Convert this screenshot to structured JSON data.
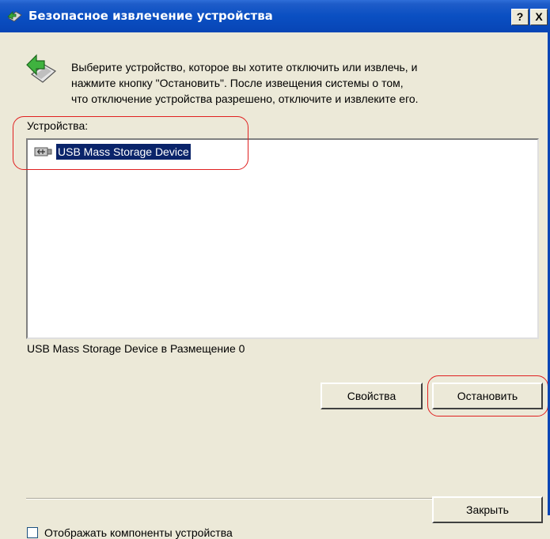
{
  "window": {
    "title": "Безопасное извлечение устройства",
    "help_button": "?",
    "close_button": "X"
  },
  "intro": {
    "line1": "Выберите устройство, которое вы хотите отключить или извлечь, и",
    "line2": "нажмите кнопку \"Остановить\". После извещения системы о том,",
    "line3": "что отключение устройства разрешено, отключите и извлеките его."
  },
  "devices": {
    "label": "Устройства:",
    "items": [
      {
        "label": "USB Mass Storage Device",
        "icon": "usb-icon",
        "selected": true
      }
    ],
    "location_text": "USB Mass Storage Device в Размещение 0"
  },
  "buttons": {
    "properties": "Свойства",
    "stop": "Остановить",
    "close": "Закрыть"
  },
  "checkbox": {
    "label": "Отображать компоненты устройства",
    "checked": false
  },
  "colors": {
    "titlebar": "#0a4fc2",
    "selection": "#0a246a",
    "annotation": "#e02020",
    "face": "#ece9d8"
  }
}
